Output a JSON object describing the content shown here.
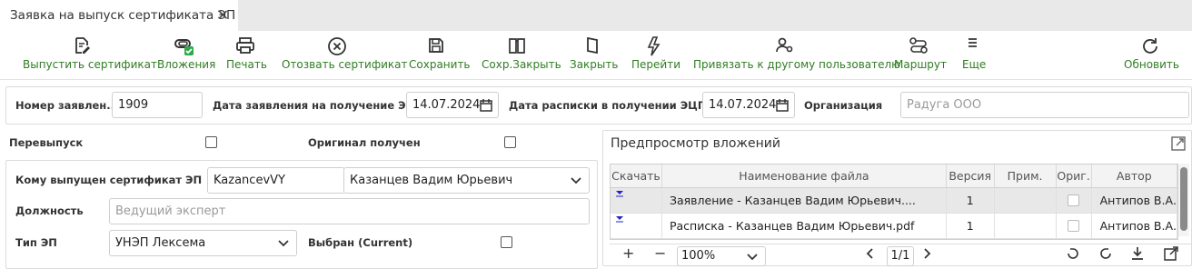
{
  "tab": {
    "title": "Заявка на выпуск сертификата ЭП",
    "close_glyph": "✕"
  },
  "toolbar": {
    "items": [
      {
        "label": "Выпустить сертификат",
        "icon": "issue-document-icon"
      },
      {
        "label": "Вложения",
        "icon": "attachment-icon"
      },
      {
        "label": "Печать",
        "icon": "printer-icon"
      },
      {
        "label": "Отозвать сертификат",
        "icon": "revoke-x-circle-icon"
      },
      {
        "label": "Сохранить",
        "icon": "save-floppy-icon"
      },
      {
        "label": "Сохр.Закрыть",
        "icon": "save-close-book-icon"
      },
      {
        "label": "Закрыть",
        "icon": "close-book-icon"
      },
      {
        "label": "Перейти",
        "icon": "lightning-icon"
      },
      {
        "label": "Привязать к другому пользователю",
        "icon": "user-settings-icon"
      },
      {
        "label": "Маршрут",
        "icon": "route-icon"
      },
      {
        "label": "Еще",
        "icon": "more-icon"
      },
      {
        "label": "Обновить",
        "icon": "refresh-icon"
      }
    ],
    "accent_color": "#2f7d22"
  },
  "header_form": {
    "number_label": "Номер заявлен...",
    "number_value": "1909",
    "date_request_label": "Дата заявления на получение ЭЦП",
    "date_request_value": "14.07.2024",
    "date_receipt_label": "Дата расписки в получении ЭЦП",
    "date_receipt_value": "14.07.2024",
    "org_label": "Организация",
    "org_placeholder": "Радуга ООО"
  },
  "flags": {
    "reissue_label": "Перевыпуск",
    "original_label": "Оригинал получен"
  },
  "cert_form": {
    "issued_to_label": "Кому выпущен сертификат ЭП",
    "login_value": "KazancevVY",
    "user_value": "Казанцев Вадим Юрьевич",
    "position_label": "Должность",
    "position_placeholder": "Ведущий эксперт",
    "type_label": "Тип ЭП",
    "type_value": "УНЭП Лексема",
    "current_label": "Выбран (Current)"
  },
  "preview": {
    "title": "Предпросмотр вложений",
    "columns": [
      "Скачать",
      "Наименование файла",
      "Версия",
      "Прим.",
      "Ориг.",
      "Автор"
    ],
    "rows": [
      {
        "file": "Заявление - Казанцев Вадим Юрьевич....",
        "version": "1",
        "note": "",
        "author": "Антипов В.А."
      },
      {
        "file": "Расписка - Казанцев Вадим Юрьевич.pdf",
        "version": "1",
        "note": "",
        "author": "Антипов В.А."
      }
    ],
    "zoom": "100%",
    "page": "1/1",
    "add_glyph": "+",
    "remove_glyph": "−"
  }
}
